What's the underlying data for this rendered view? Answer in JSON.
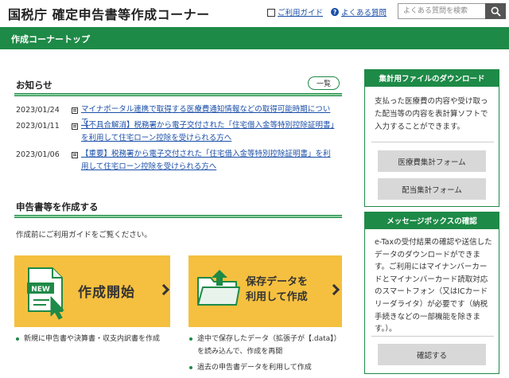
{
  "header": {
    "site_title": "国税庁 確定申告書等作成コーナー",
    "guide_link": "ご利用ガイド",
    "faq_link": "よくある質問",
    "search_placeholder": "よくある質問を検索"
  },
  "topbar": {
    "title": "作成コーナートップ"
  },
  "notices": {
    "heading": "お知らせ",
    "more_label": "一覧",
    "items": [
      {
        "date": "2023/01/24",
        "text": "マイナポータル連携で取得する医療費通知情報などの取得可能時期について"
      },
      {
        "date": "2023/01/11",
        "text": "【不具合解消】税務署から電子交付された「住宅借入金等特別控除証明書」を利用して住宅ローン控除を受けられる方へ"
      },
      {
        "date": "2023/01/06",
        "text": "【重要】税務署から電子交付された「住宅借入金等特別控除証明書」を利用して住宅ローン控除を受けられる方へ"
      }
    ]
  },
  "create": {
    "heading": "申告書等を作成する",
    "description": "作成前にご利用ガイドをご覧ください。",
    "new_badge": "NEW",
    "start_label": "作成開始",
    "resume_line1": "保存データを",
    "resume_line2": "利用して作成",
    "start_bullet": "新規に申告書や決算書・収支内訳書を作成",
    "resume_bullet1": "途中で保存したデータ（拡張子が【.data】）を読み込んで、作成を再開",
    "resume_bullet2": "過去の申告書データを利用して作成"
  },
  "download_panel": {
    "title": "集計用ファイルのダウンロード",
    "text": "支払った医療費の内容や受け取った配当等の内容を表計算ソフトで入力することができます。",
    "medical_button": "医療費集計フォーム",
    "dividend_button": "配当集計フォーム"
  },
  "message_panel": {
    "title": "メッセージボックスの確認",
    "text": "e-Taxの受付結果の確認や送信したデータのダウンロードができます。ご利用にはマイナンバーカードとマイナンバーカード読取対応のスマートフォン（又はICカードリーダライタ）が必要です（納税手続きなどの一部機能を除きます。）。",
    "confirm_button": "確認する"
  },
  "colors": {
    "brand_green": "#1e8a47",
    "card_yellow": "#f5c03f",
    "link_blue": "#1a4ea8"
  },
  "icons": [
    "book-icon",
    "question-icon",
    "search-icon",
    "document-icon",
    "new-document-icon",
    "folder-upload-icon",
    "chevron-right-icon"
  ]
}
